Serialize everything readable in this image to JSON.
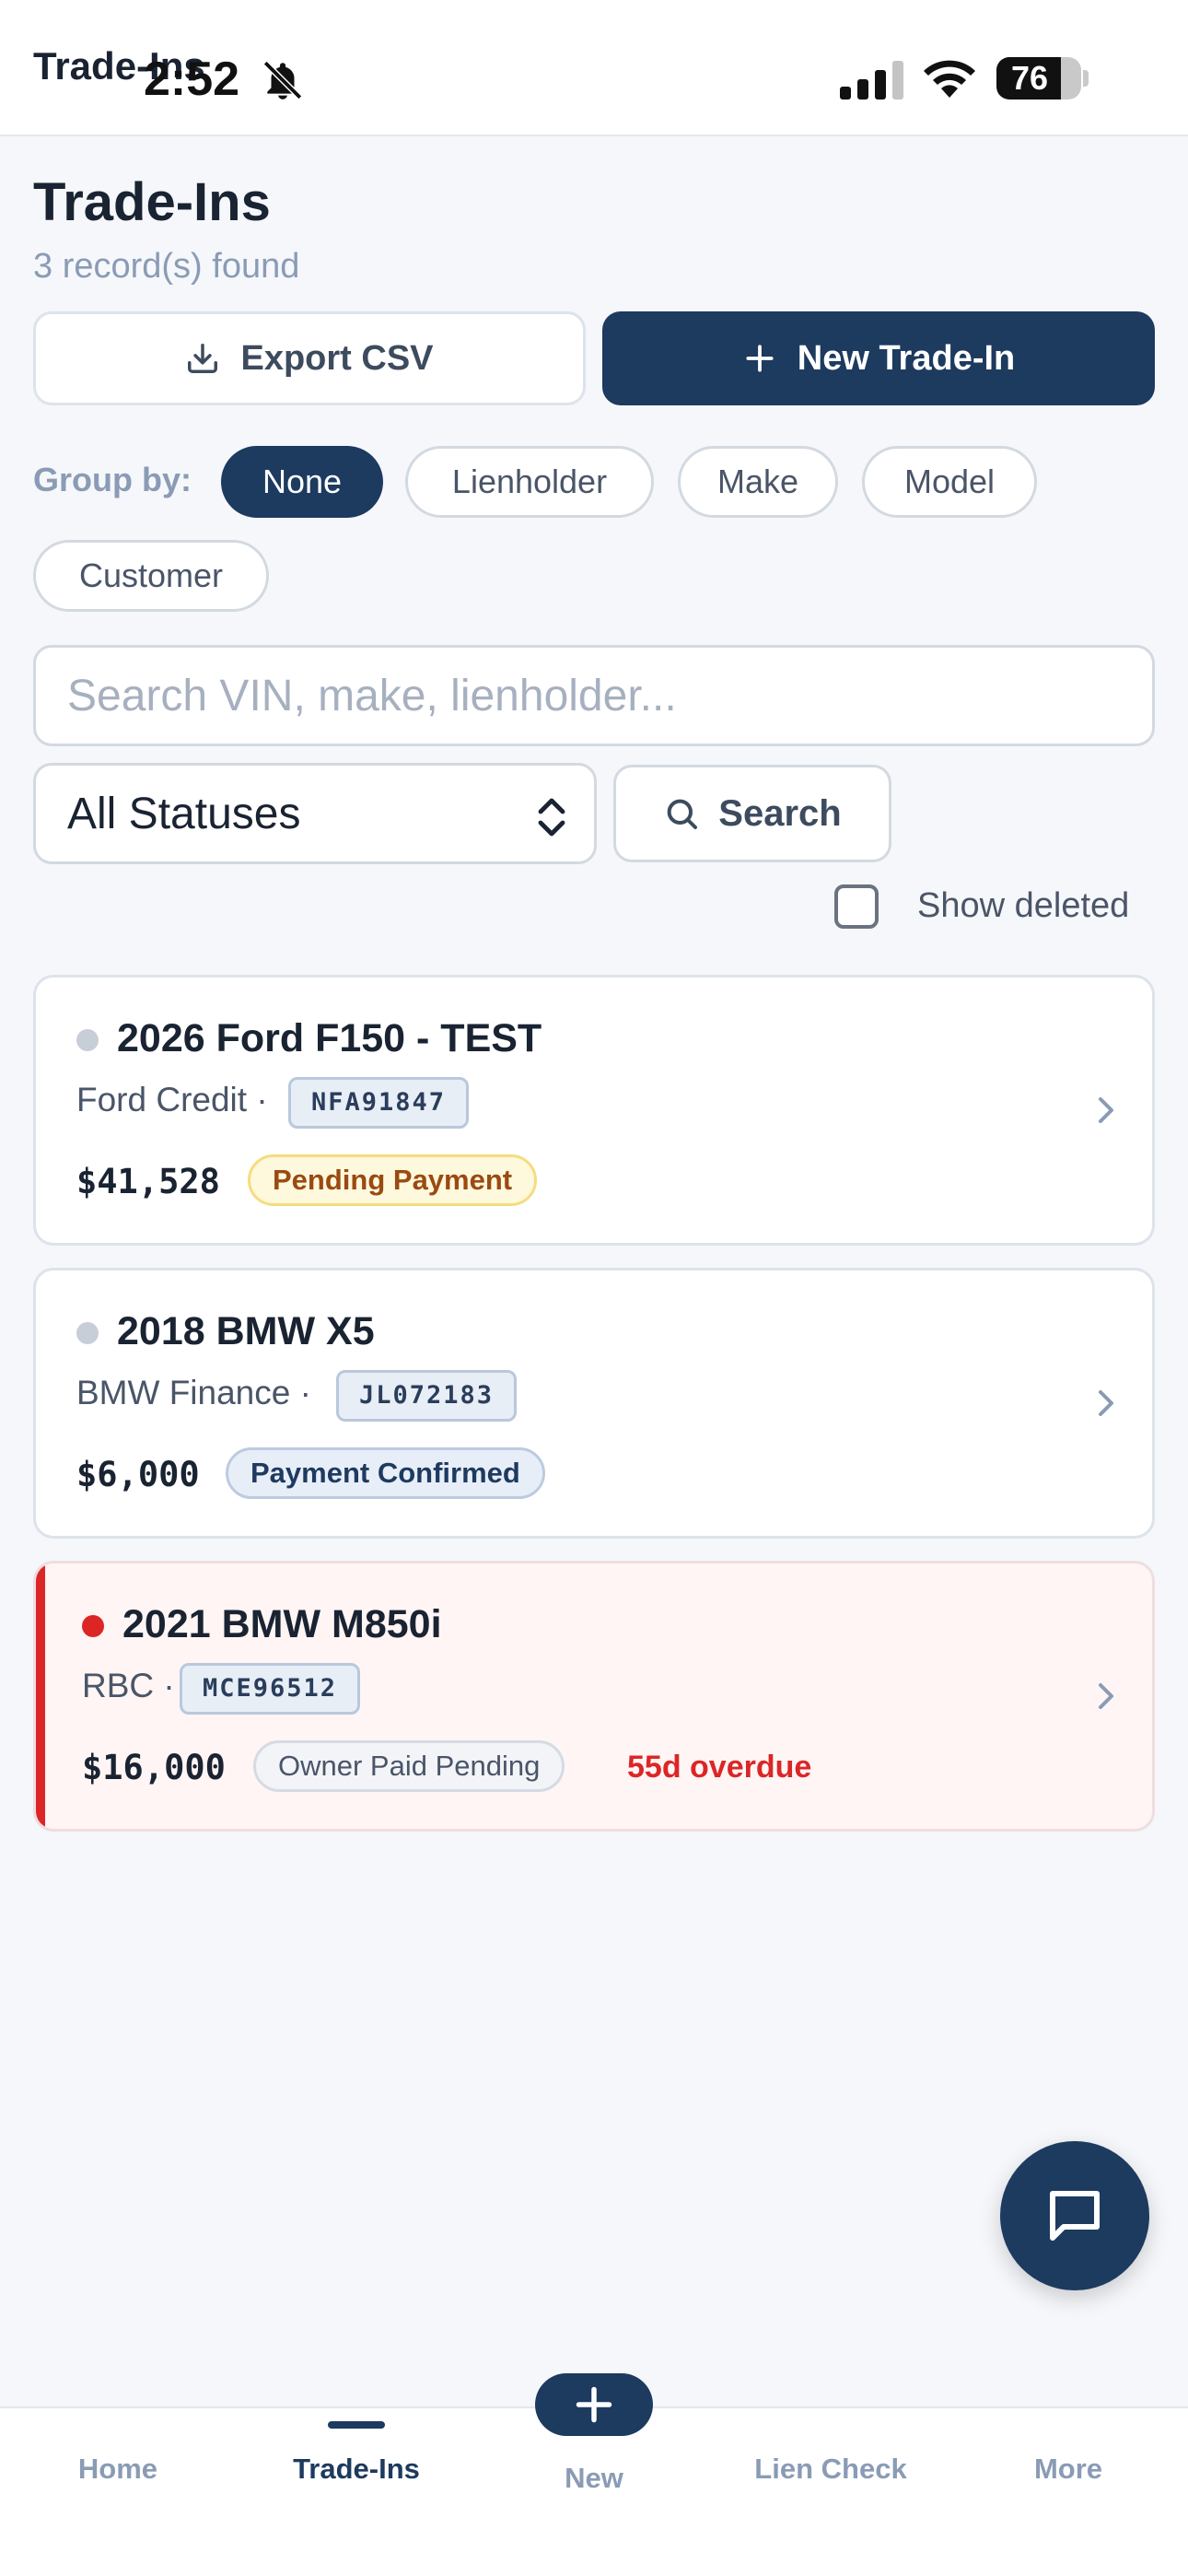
{
  "status_bar": {
    "page_title": "Trade-Ins",
    "time": "2:52",
    "battery": "76",
    "battery_level": 0.76
  },
  "header": {
    "title": "Trade-Ins",
    "record_count": "3 record(s) found"
  },
  "actions": {
    "export_label": "Export CSV",
    "new_label": "New Trade-In"
  },
  "group_by": {
    "label": "Group by:",
    "options": [
      "None",
      "Lienholder",
      "Make",
      "Model",
      "Customer"
    ],
    "selected": "None"
  },
  "filters": {
    "search_placeholder": "Search VIN, make, lienholder...",
    "status_value": "All Statuses",
    "search_button": "Search",
    "show_deleted_label": "Show deleted",
    "show_deleted_checked": false
  },
  "trade_ins": [
    {
      "title": "2026 Ford F150 - TEST",
      "lienholder": "Ford Credit ·",
      "vin": "NFA91847",
      "amount": "$41,528",
      "status": "Pending Payment",
      "overdue": ""
    },
    {
      "title": "2018 BMW X5",
      "lienholder": "BMW Finance ·",
      "vin": "JL072183",
      "amount": "$6,000",
      "status": "Payment Confirmed",
      "overdue": ""
    },
    {
      "title": "2021 BMW M850i",
      "lienholder": "RBC ·",
      "vin": "MCE96512",
      "amount": "$16,000",
      "status": "Owner Paid Pending",
      "overdue": "55d overdue"
    }
  ],
  "tabs": {
    "home": "Home",
    "trade_ins": "Trade-Ins",
    "new": "New",
    "lien_check": "Lien Check",
    "more": "More",
    "active": "Trade-Ins"
  },
  "colors": {
    "primary": "#1d3a5f",
    "danger": "#dc2626",
    "muted": "#8a9bb5"
  }
}
